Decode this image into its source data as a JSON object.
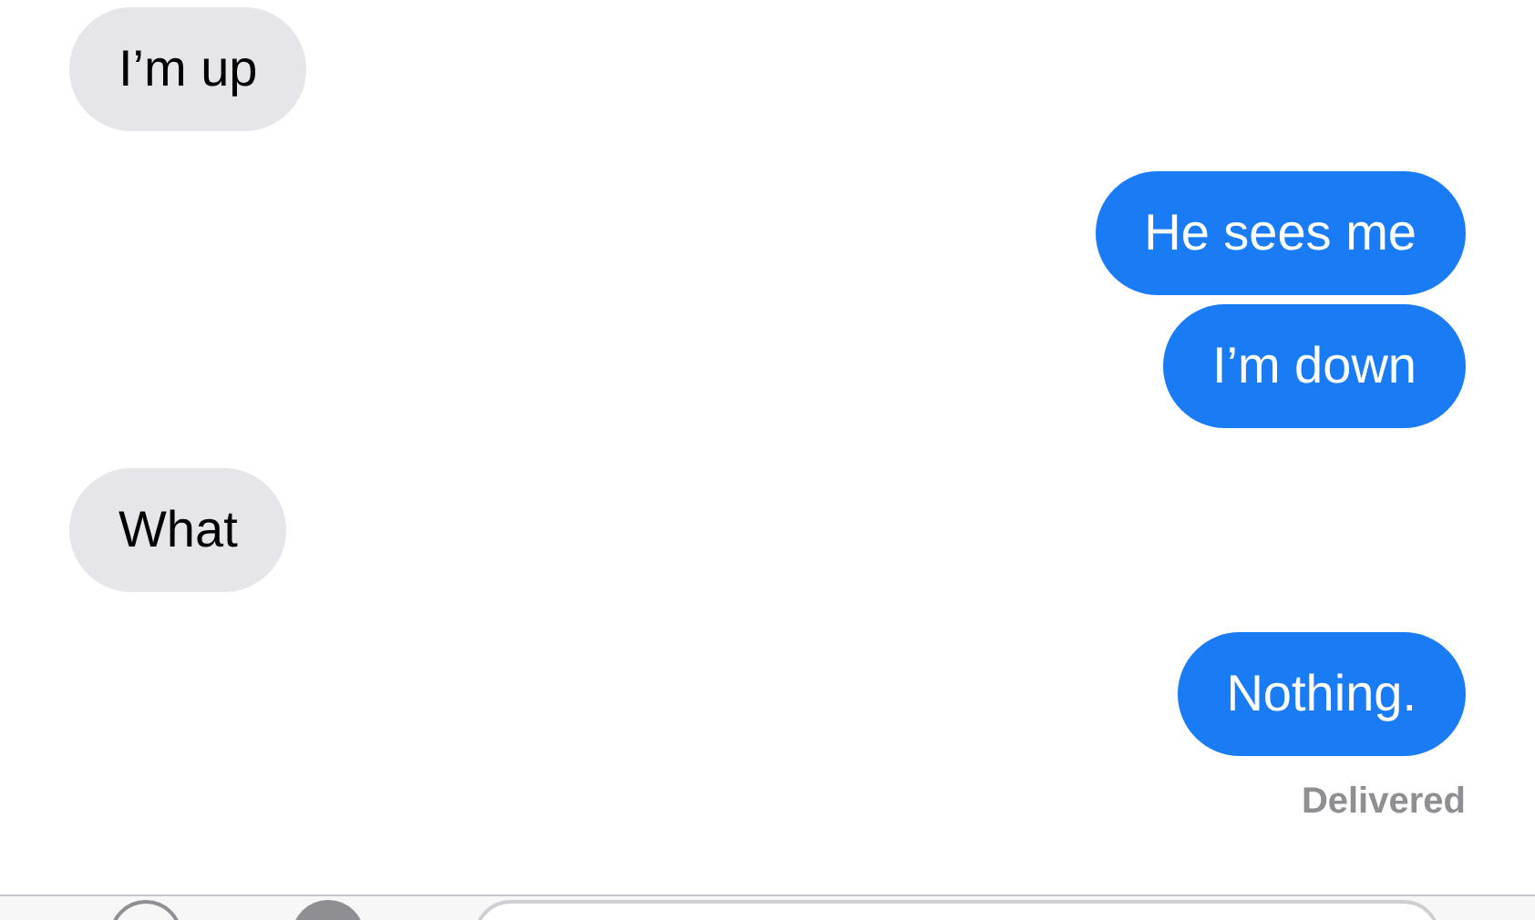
{
  "messages": [
    {
      "kind": "incoming",
      "text": "I’m up"
    },
    {
      "kind": "outgoing",
      "text": "He sees me"
    },
    {
      "kind": "outgoing",
      "text": "I’m down"
    },
    {
      "kind": "incoming",
      "text": "What"
    },
    {
      "kind": "outgoing",
      "text": "Nothing."
    }
  ],
  "status": "Delivered"
}
